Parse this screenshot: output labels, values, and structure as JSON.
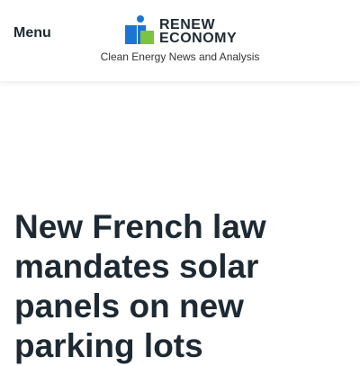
{
  "header": {
    "menu_label": "Menu",
    "logo": {
      "line1": "RENEW",
      "line2": "ECONOMY",
      "colors": {
        "blue": "#1b76d3",
        "green": "#7cc243",
        "text": "#1e2a33"
      }
    },
    "tagline": "Clean Energy News and Analysis"
  },
  "article": {
    "title": "New French law mandates solar panels on new parking lots"
  }
}
